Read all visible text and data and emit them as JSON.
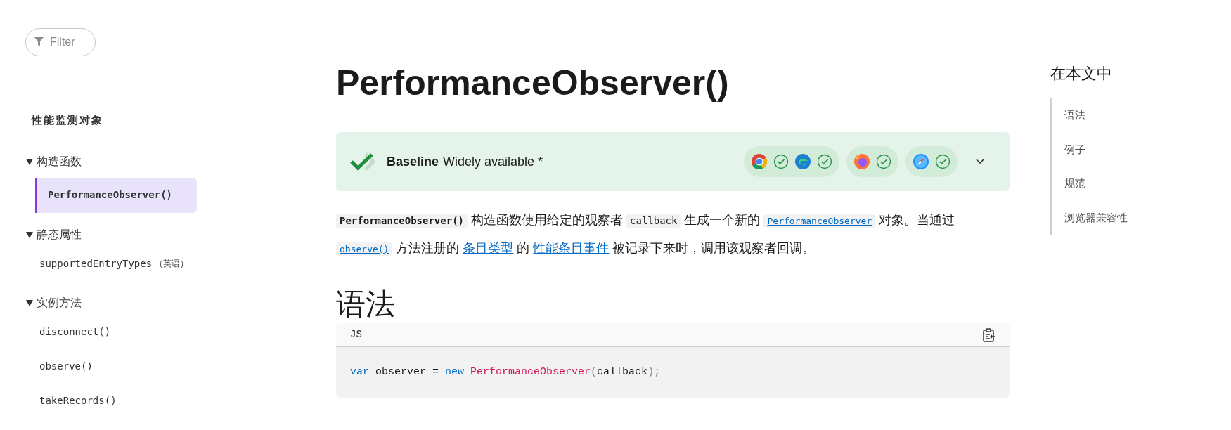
{
  "sidebar": {
    "filter": {
      "placeholder": "Filter"
    },
    "heading": "性能监测对象",
    "groups": [
      {
        "label": "构造函数",
        "expanded": true,
        "children": [
          {
            "label": "PerformanceObserver()",
            "selected": true
          }
        ]
      },
      {
        "label": "静态属性",
        "expanded": true,
        "children": [
          {
            "label": "supportedEntryTypes",
            "note": "（英语）",
            "selected": false
          }
        ]
      },
      {
        "label": "实例方法",
        "expanded": true,
        "children": [
          {
            "label": "disconnect()",
            "selected": false
          },
          {
            "label": "observe()",
            "selected": false
          },
          {
            "label": "takeRecords()",
            "selected": false
          }
        ]
      }
    ]
  },
  "article": {
    "title": "PerformanceObserver()",
    "baseline": {
      "label": "Baseline",
      "status": "Widely available *"
    },
    "intro": [
      {
        "kind": "code",
        "text": "PerformanceObserver()"
      },
      {
        "kind": "text",
        "text": " 构造函数使用给定的观察者 "
      },
      {
        "kind": "code",
        "text": "callback"
      },
      {
        "kind": "text",
        "text": " 生成一个新的 "
      },
      {
        "kind": "codelink",
        "text": "PerformanceObserver"
      },
      {
        "kind": "text",
        "text": " 对象。当通过 "
      },
      {
        "kind": "codelink",
        "text": "observe()"
      },
      {
        "kind": "text",
        "text": " 方法注册的 "
      },
      {
        "kind": "link",
        "text": "条目类型"
      },
      {
        "kind": "text",
        "text": " 的 "
      },
      {
        "kind": "link",
        "text": "性能条目事件"
      },
      {
        "kind": "text",
        "text": " 被记录下来时，调用该观察者回调。"
      }
    ],
    "section_heading": "语法",
    "code_block": {
      "language": "JS",
      "tokens": [
        {
          "kind": "keyword",
          "text": "var"
        },
        {
          "kind": "plain",
          "text": " observer = "
        },
        {
          "kind": "keyword",
          "text": "new"
        },
        {
          "kind": "function",
          "text": " PerformanceObserver"
        },
        {
          "kind": "punct",
          "text": "("
        },
        {
          "kind": "plain",
          "text": "callback"
        },
        {
          "kind": "punct",
          "text": ");"
        }
      ]
    }
  },
  "toc": {
    "heading": "在本文中",
    "items": [
      "语法",
      "例子",
      "规范",
      "浏览器兼容性"
    ]
  }
}
